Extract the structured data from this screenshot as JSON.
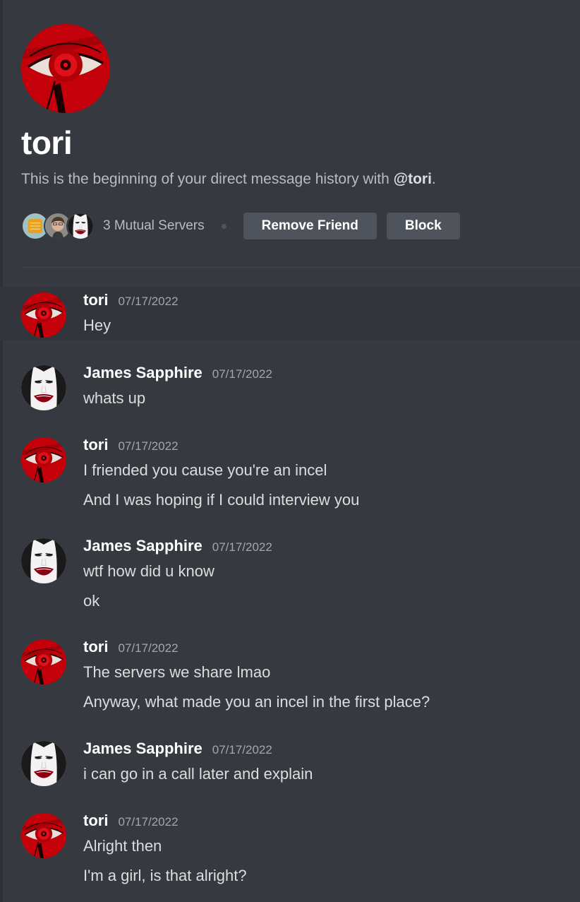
{
  "profile": {
    "name": "tori",
    "intro_text": "This is the beginning of your direct message history with ",
    "intro_handle": "@tori",
    "intro_end": "."
  },
  "mutual": {
    "label": "3 Mutual Servers",
    "remove_friend": "Remove Friend",
    "block": "Block"
  },
  "messages": [
    {
      "author": "tori",
      "time": "07/17/2022",
      "lines": [
        "Hey"
      ]
    },
    {
      "author": "James Sapphire",
      "time": "07/17/2022",
      "lines": [
        "whats up"
      ]
    },
    {
      "author": "tori",
      "time": "07/17/2022",
      "lines": [
        "I friended you cause you're an incel",
        "And I was hoping if I could interview you"
      ]
    },
    {
      "author": "James Sapphire",
      "time": "07/17/2022",
      "lines": [
        "wtf how did u know",
        "ok"
      ]
    },
    {
      "author": "tori",
      "time": "07/17/2022",
      "lines": [
        "The servers we share lmao",
        "Anyway, what made you an incel in the first place?"
      ]
    },
    {
      "author": "James Sapphire",
      "time": "07/17/2022",
      "lines": [
        "i can go in a call later and explain"
      ]
    },
    {
      "author": "tori",
      "time": "07/17/2022",
      "lines": [
        "Alright then",
        "I'm a girl, is that alright?"
      ]
    }
  ],
  "colors": {
    "background": "#36393f",
    "button": "#4f545c",
    "tori_avatar_red": "#c8000a"
  }
}
